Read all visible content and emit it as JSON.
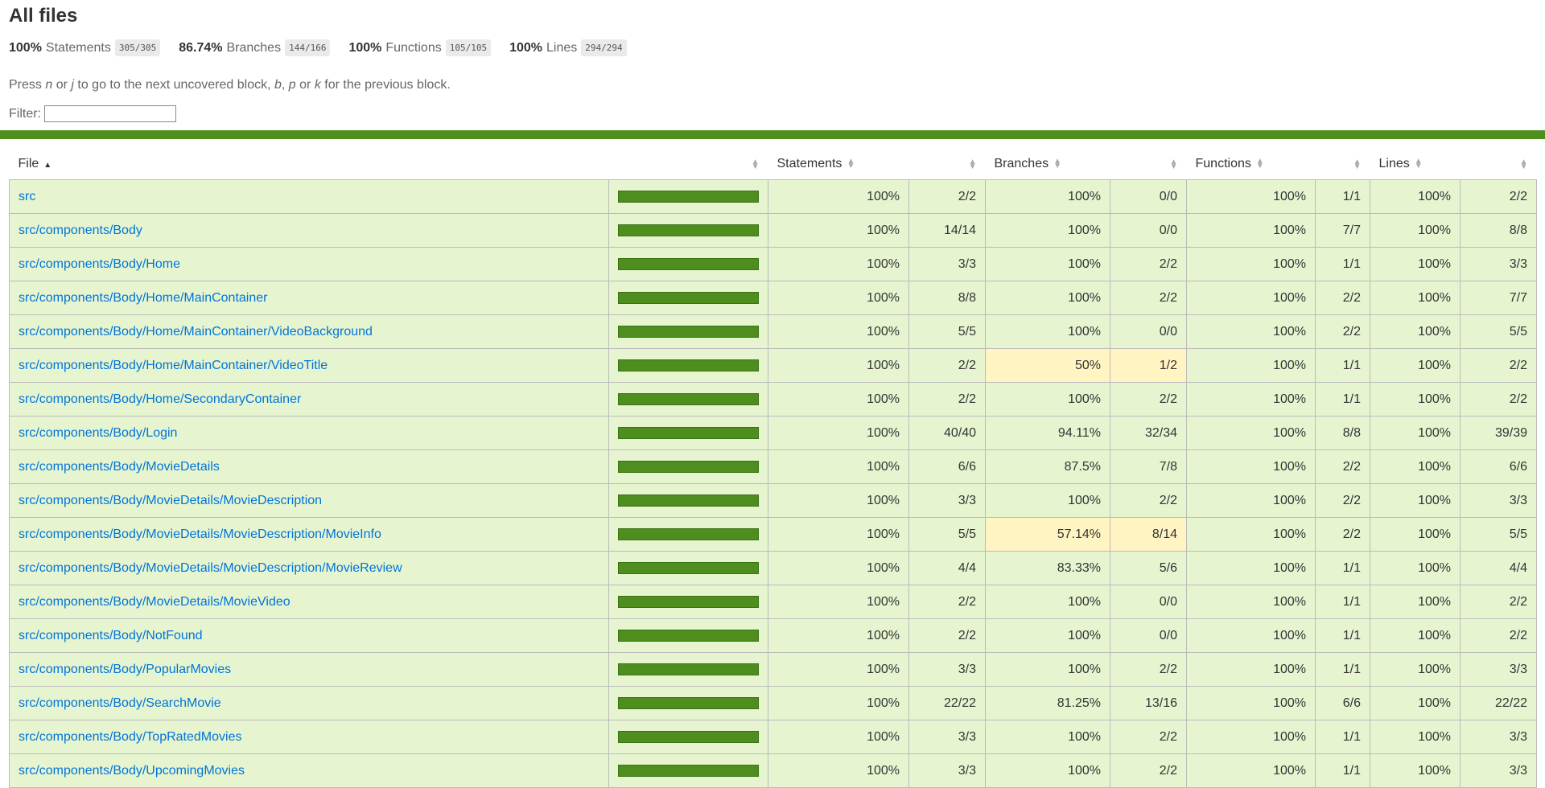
{
  "page_title": "All files",
  "summary": [
    {
      "pct": "100%",
      "label": "Statements",
      "fraction": "305/305"
    },
    {
      "pct": "86.74%",
      "label": "Branches",
      "fraction": "144/166"
    },
    {
      "pct": "100%",
      "label": "Functions",
      "fraction": "105/105"
    },
    {
      "pct": "100%",
      "label": "Lines",
      "fraction": "294/294"
    }
  ],
  "hint": {
    "p1": "Press ",
    "k1": "n",
    "p2": " or ",
    "k2": "j",
    "p3": " to go to the next uncovered block, ",
    "k3": "b",
    "p4": ", ",
    "k4": "p",
    "p5": " or ",
    "k5": "k",
    "p6": " for the previous block."
  },
  "filter": {
    "label": "Filter:",
    "value": ""
  },
  "colors": {
    "high_bg": "#e6f5d0",
    "medium_bg": "#fff4c2",
    "bar": "#4d8e1e",
    "link": "#0074d9"
  },
  "table": {
    "headers": {
      "file": "File",
      "statements": "Statements",
      "branches": "Branches",
      "functions": "Functions",
      "lines": "Lines"
    },
    "rows": [
      {
        "file": "src",
        "coverage": 1.0,
        "s_pct": "100%",
        "s": "2/2",
        "b_pct": "100%",
        "b": "0/0",
        "f_pct": "100%",
        "f": "1/1",
        "l_pct": "100%",
        "l": "2/2",
        "b_level": "high"
      },
      {
        "file": "src/components/Body",
        "coverage": 1.0,
        "s_pct": "100%",
        "s": "14/14",
        "b_pct": "100%",
        "b": "0/0",
        "f_pct": "100%",
        "f": "7/7",
        "l_pct": "100%",
        "l": "8/8",
        "b_level": "high"
      },
      {
        "file": "src/components/Body/Home",
        "coverage": 1.0,
        "s_pct": "100%",
        "s": "3/3",
        "b_pct": "100%",
        "b": "2/2",
        "f_pct": "100%",
        "f": "1/1",
        "l_pct": "100%",
        "l": "3/3",
        "b_level": "high"
      },
      {
        "file": "src/components/Body/Home/MainContainer",
        "coverage": 1.0,
        "s_pct": "100%",
        "s": "8/8",
        "b_pct": "100%",
        "b": "2/2",
        "f_pct": "100%",
        "f": "2/2",
        "l_pct": "100%",
        "l": "7/7",
        "b_level": "high"
      },
      {
        "file": "src/components/Body/Home/MainContainer/VideoBackground",
        "coverage": 1.0,
        "s_pct": "100%",
        "s": "5/5",
        "b_pct": "100%",
        "b": "0/0",
        "f_pct": "100%",
        "f": "2/2",
        "l_pct": "100%",
        "l": "5/5",
        "b_level": "high"
      },
      {
        "file": "src/components/Body/Home/MainContainer/VideoTitle",
        "coverage": 1.0,
        "s_pct": "100%",
        "s": "2/2",
        "b_pct": "50%",
        "b": "1/2",
        "f_pct": "100%",
        "f": "1/1",
        "l_pct": "100%",
        "l": "2/2",
        "b_level": "medium"
      },
      {
        "file": "src/components/Body/Home/SecondaryContainer",
        "coverage": 1.0,
        "s_pct": "100%",
        "s": "2/2",
        "b_pct": "100%",
        "b": "2/2",
        "f_pct": "100%",
        "f": "1/1",
        "l_pct": "100%",
        "l": "2/2",
        "b_level": "high"
      },
      {
        "file": "src/components/Body/Login",
        "coverage": 1.0,
        "s_pct": "100%",
        "s": "40/40",
        "b_pct": "94.11%",
        "b": "32/34",
        "f_pct": "100%",
        "f": "8/8",
        "l_pct": "100%",
        "l": "39/39",
        "b_level": "high"
      },
      {
        "file": "src/components/Body/MovieDetails",
        "coverage": 1.0,
        "s_pct": "100%",
        "s": "6/6",
        "b_pct": "87.5%",
        "b": "7/8",
        "f_pct": "100%",
        "f": "2/2",
        "l_pct": "100%",
        "l": "6/6",
        "b_level": "high"
      },
      {
        "file": "src/components/Body/MovieDetails/MovieDescription",
        "coverage": 1.0,
        "s_pct": "100%",
        "s": "3/3",
        "b_pct": "100%",
        "b": "2/2",
        "f_pct": "100%",
        "f": "2/2",
        "l_pct": "100%",
        "l": "3/3",
        "b_level": "high"
      },
      {
        "file": "src/components/Body/MovieDetails/MovieDescription/MovieInfo",
        "coverage": 1.0,
        "s_pct": "100%",
        "s": "5/5",
        "b_pct": "57.14%",
        "b": "8/14",
        "f_pct": "100%",
        "f": "2/2",
        "l_pct": "100%",
        "l": "5/5",
        "b_level": "medium"
      },
      {
        "file": "src/components/Body/MovieDetails/MovieDescription/MovieReview",
        "coverage": 1.0,
        "s_pct": "100%",
        "s": "4/4",
        "b_pct": "83.33%",
        "b": "5/6",
        "f_pct": "100%",
        "f": "1/1",
        "l_pct": "100%",
        "l": "4/4",
        "b_level": "high"
      },
      {
        "file": "src/components/Body/MovieDetails/MovieVideo",
        "coverage": 1.0,
        "s_pct": "100%",
        "s": "2/2",
        "b_pct": "100%",
        "b": "0/0",
        "f_pct": "100%",
        "f": "1/1",
        "l_pct": "100%",
        "l": "2/2",
        "b_level": "high"
      },
      {
        "file": "src/components/Body/NotFound",
        "coverage": 1.0,
        "s_pct": "100%",
        "s": "2/2",
        "b_pct": "100%",
        "b": "0/0",
        "f_pct": "100%",
        "f": "1/1",
        "l_pct": "100%",
        "l": "2/2",
        "b_level": "high"
      },
      {
        "file": "src/components/Body/PopularMovies",
        "coverage": 1.0,
        "s_pct": "100%",
        "s": "3/3",
        "b_pct": "100%",
        "b": "2/2",
        "f_pct": "100%",
        "f": "1/1",
        "l_pct": "100%",
        "l": "3/3",
        "b_level": "high"
      },
      {
        "file": "src/components/Body/SearchMovie",
        "coverage": 1.0,
        "s_pct": "100%",
        "s": "22/22",
        "b_pct": "81.25%",
        "b": "13/16",
        "f_pct": "100%",
        "f": "6/6",
        "l_pct": "100%",
        "l": "22/22",
        "b_level": "high"
      },
      {
        "file": "src/components/Body/TopRatedMovies",
        "coverage": 1.0,
        "s_pct": "100%",
        "s": "3/3",
        "b_pct": "100%",
        "b": "2/2",
        "f_pct": "100%",
        "f": "1/1",
        "l_pct": "100%",
        "l": "3/3",
        "b_level": "high"
      },
      {
        "file": "src/components/Body/UpcomingMovies",
        "coverage": 1.0,
        "s_pct": "100%",
        "s": "3/3",
        "b_pct": "100%",
        "b": "2/2",
        "f_pct": "100%",
        "f": "1/1",
        "l_pct": "100%",
        "l": "3/3",
        "b_level": "high"
      }
    ]
  }
}
